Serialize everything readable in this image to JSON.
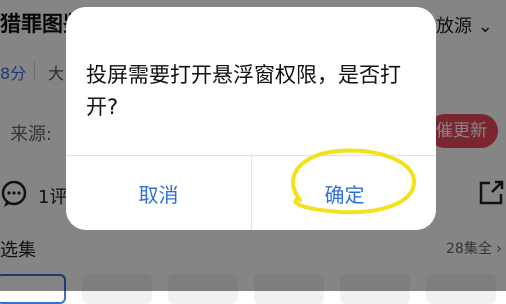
{
  "background": {
    "title": "猎罪图鉴",
    "source_switch": "放源",
    "rating": "8分",
    "meta_text": "大",
    "source_label": "来源:",
    "refresh_button": "催更新",
    "comment_text": "1评",
    "episodes_title": "选集",
    "episodes_count": "28集全 ›"
  },
  "dialog": {
    "message": "投屏需要打开悬浮窗权限，是否打开?",
    "cancel_label": "取消",
    "confirm_label": "确定"
  },
  "colors": {
    "accent": "#2f6fd6",
    "highlight": "#f2e21b",
    "refresh": "#e84a5f"
  }
}
